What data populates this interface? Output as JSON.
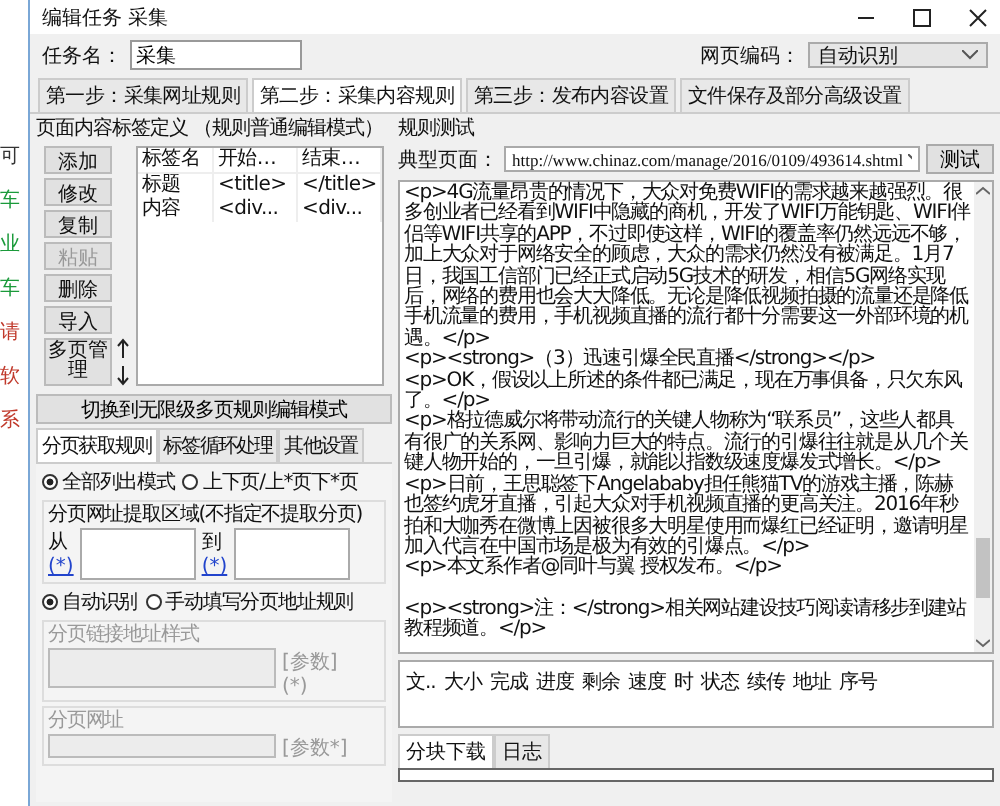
{
  "background_window": {
    "texts": [
      {
        "text": "可",
        "color": "#333333"
      },
      {
        "text": "车",
        "color": "#1a9a3a"
      },
      {
        "text": "业",
        "color": "#1a9a3a"
      },
      {
        "text": "车",
        "color": "#1a9a3a"
      },
      {
        "text": "请",
        "color": "#c0392b"
      },
      {
        "text": "软",
        "color": "#c0392b"
      },
      {
        "text": "系",
        "color": "#c0392b"
      }
    ]
  },
  "window": {
    "title": "编辑任务 采集"
  },
  "task_name": {
    "label": "任务名：",
    "value": "采集"
  },
  "encoding": {
    "label": "网页编码：",
    "value": "自动识别"
  },
  "tabs": [
    {
      "label": "第一步：采集网址规则",
      "selected": false
    },
    {
      "label": "第二步：采集内容规则",
      "selected": true
    },
    {
      "label": "第三步：发布内容设置",
      "selected": false
    },
    {
      "label": "文件保存及部分高级设置",
      "selected": false
    }
  ],
  "tag_panel": {
    "title": "页面内容标签定义 （规则普通编辑模式）",
    "buttons": [
      {
        "label": "添加",
        "disabled": false
      },
      {
        "label": "修改",
        "disabled": false
      },
      {
        "label": "复制",
        "disabled": false
      },
      {
        "label": "粘贴",
        "disabled": true
      },
      {
        "label": "删除",
        "disabled": false
      },
      {
        "label": "导入",
        "disabled": false
      }
    ],
    "multipage_button": "多页管理",
    "columns": [
      "标签名",
      "开始…",
      "结束…"
    ],
    "rows": [
      [
        "标题",
        "<title>",
        "</title>"
      ],
      [
        "内容",
        "<div...",
        "<div..."
      ]
    ]
  },
  "switch_button": "切换到无限级多页规则编辑模式",
  "sub_tabs": [
    {
      "label": "分页获取规则",
      "selected": true
    },
    {
      "label": "标签循环处理",
      "selected": false
    },
    {
      "label": "其他设置",
      "selected": false
    }
  ],
  "list_mode": [
    {
      "label": "全部列出模式",
      "selected": true
    },
    {
      "label": "上下页/上*页下*页",
      "selected": false
    }
  ],
  "region": {
    "legend": "分页网址提取区域(不指定不提取分页)",
    "from_label": "从",
    "from_link": "(*)",
    "to_label": "到",
    "to_link": "(*)"
  },
  "detect_mode": [
    {
      "label": "自动识别",
      "selected": true
    },
    {
      "label": "手动填写分页地址规则",
      "selected": false
    }
  ],
  "link_style": {
    "legend": "分页链接地址样式",
    "param": "[参数]",
    "star": "(*)",
    "disabled": true
  },
  "page_url": {
    "legend": "分页网址",
    "param": "[参数*]",
    "disabled": true
  },
  "rule_test": {
    "title": "规则测试",
    "url_label": "典型页面：",
    "url": "http://www.chinaz.com/manage/2016/0109/493614.shtml",
    "test_button": "测试",
    "paragraphs": [
      "<p>4G流量昂贵的情况下，大众对免费WIFI的需求越来越强烈。很多创业者已经看到WIFI中隐藏的商机，开发了WIFI万能钥匙、WIFI伴侣等WIFI共享的APP，不过即使这样，WIFI的覆盖率仍然远远不够，加上大众对于网络安全的顾虑，大众的需求仍然没有被满足。1月7日，我国工信部门已经正式启动5G技术的研发，相信5G网络实现后，网络的费用也会大大降低。无论是降低视频拍摄的流量还是降低手机流量的费用，手机视频直播的流行都十分需要这一外部环境的机遇。</p>",
      "<p><strong>（3）迅速引爆全民直播</strong></p>",
      "<p>OK，假设以上所述的条件都已满足，现在万事俱备，只欠东风了。</p>",
      "<p>格拉德威尔将带动流行的关键人物称为“联系员”，这些人都具有很广的关系网、影响力巨大的特点。流行的引爆往往就是从几个关键人物开始的，一旦引爆，就能以指数级速度爆发式增长。</p>",
      "<p>日前，王思聪签下Angelababy担任熊猫TV的游戏主播，陈赫也签约虎牙直播，引起大众对手机视频直播的更高关注。2016年秒拍和大咖秀在微博上因被很多大明星使用而爆红已经证明，邀请明星加入代言在中国市场是极为有效的引爆点。</p>",
      "<p>本文系作者@同叶与翼 授权发布。</p>"
    ],
    "footer_paragraph": "<p><strong>注：</strong>相关网站建设技巧阅读请移步到建站教程频道。</p>"
  },
  "download_columns": [
    "文..",
    "大小",
    "完成",
    "进度",
    "剩余",
    "速度",
    "时",
    "状态",
    "续传",
    "地址",
    "序号"
  ],
  "bottom_tabs": [
    {
      "label": "分块下载",
      "selected": true
    },
    {
      "label": "日志",
      "selected": false
    }
  ],
  "progress": {
    "level": 0
  }
}
